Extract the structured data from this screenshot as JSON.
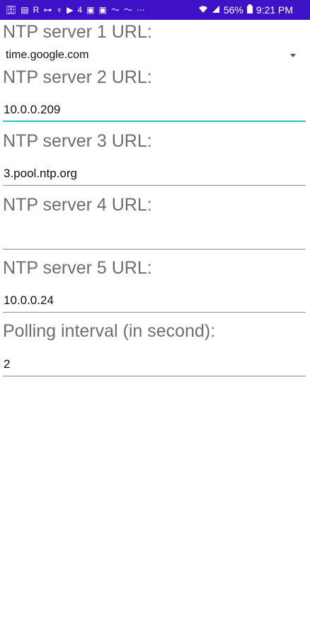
{
  "status_bar": {
    "left_icons": [
      "🗄",
      "▤",
      "R",
      "⊶",
      "♆",
      "▶",
      "4",
      "▣",
      "▣",
      "〜",
      "〜",
      "⋯"
    ],
    "battery": "56%",
    "time": "9:21 PM",
    "bg_color": "#3d12c7"
  },
  "form": {
    "ntp1": {
      "label": "NTP server 1 URL:",
      "value": "time.google.com"
    },
    "ntp2": {
      "label": "NTP server 2 URL:",
      "value": "10.0.0.209"
    },
    "ntp3": {
      "label": "NTP server 3 URL:",
      "value": "3.pool.ntp.org"
    },
    "ntp4": {
      "label": "NTP server 4 URL:",
      "value": ""
    },
    "ntp5": {
      "label": "NTP server 5 URL:",
      "value": "10.0.0.24"
    },
    "polling": {
      "label": "Polling interval (in second):",
      "value": "2"
    }
  },
  "colors": {
    "focus_accent": "#26c6c3",
    "label_gray": "#6e6e6e"
  }
}
